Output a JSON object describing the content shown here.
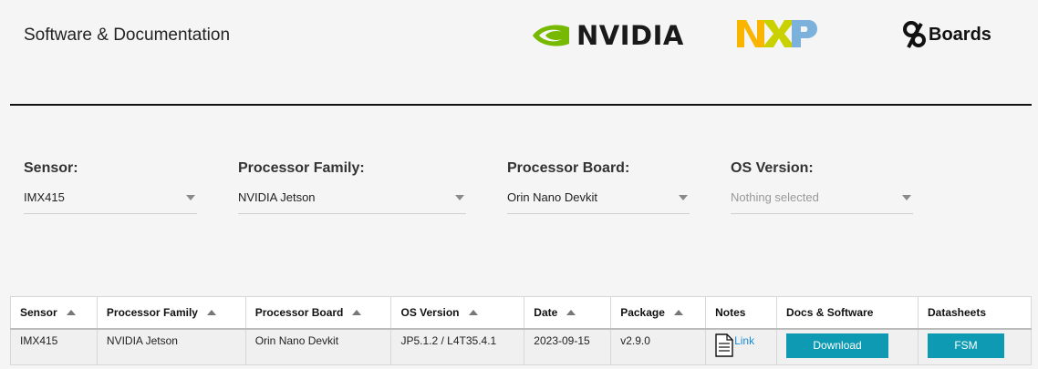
{
  "header": {
    "title": "Software & Documentation",
    "logos": {
      "nvidia": "NVIDIA",
      "nxp": "NXP",
      "boards": "Boards"
    },
    "colors": {
      "nvidia_green": "#76b900",
      "nxp_yellow": "#f9b500",
      "nxp_green": "#c9d200",
      "nxp_blue": "#7bb1db"
    }
  },
  "filters": {
    "sensor": {
      "label": "Sensor:",
      "value": "IMX415"
    },
    "processor_family": {
      "label": "Processor Family:",
      "value": "NVIDIA Jetson"
    },
    "processor_board": {
      "label": "Processor Board:",
      "value": "Orin Nano Devkit"
    },
    "os_version": {
      "label": "OS Version:",
      "value": "Nothing selected"
    }
  },
  "table": {
    "headers": {
      "sensor": "Sensor",
      "processor_family": "Processor Family",
      "processor_board": "Processor Board",
      "os_version": "OS Version",
      "date": "Date",
      "package": "Package",
      "notes": "Notes",
      "docs": "Docs & Software",
      "datasheets": "Datasheets"
    },
    "rows": [
      {
        "sensor": "IMX415",
        "processor_family": "NVIDIA Jetson",
        "processor_board": "Orin Nano Devkit",
        "os_version": "JP5.1.2 / L4T35.4.1",
        "date": "2023-09-15",
        "package": "v2.9.0",
        "notes_link": "Link",
        "download": "Download",
        "datasheet": "FSM"
      }
    ]
  },
  "colors": {
    "button": "#0d9ab2",
    "link": "#1a8cd8"
  }
}
